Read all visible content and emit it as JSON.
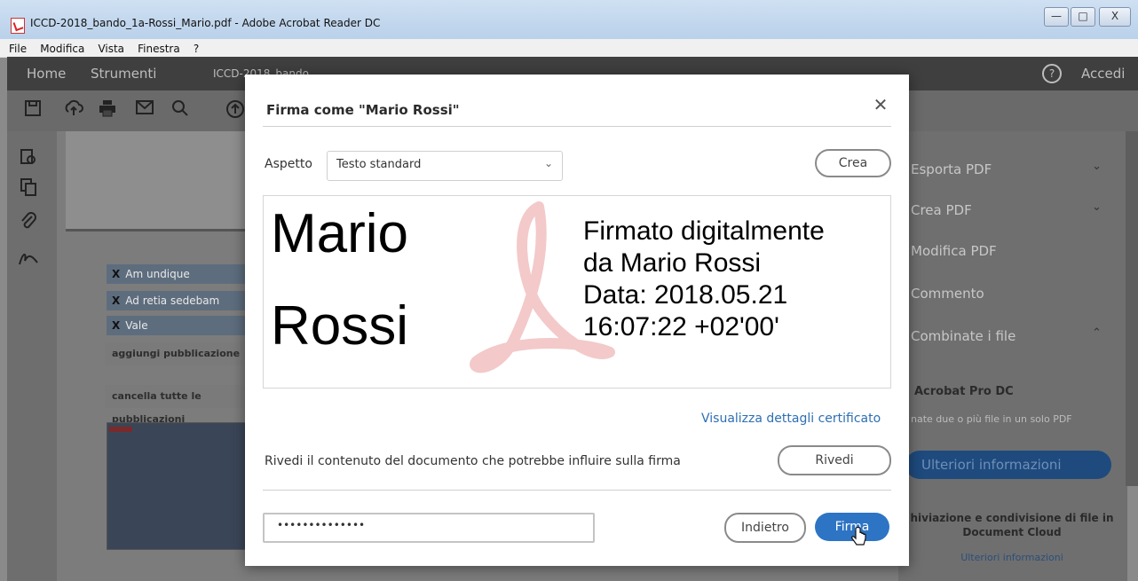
{
  "window": {
    "title": "ICCD-2018_bando_1a-Rossi_Mario.pdf - Adobe Acrobat Reader DC",
    "controls": [
      "—",
      "□",
      "X"
    ]
  },
  "menu": [
    "File",
    "Modifica",
    "Vista",
    "Finestra",
    "?"
  ],
  "topnav": {
    "home": "Home",
    "tools": "Strumenti",
    "doc_tab": "ICCD-2018_bando...",
    "help": "?",
    "signin": "Accedi"
  },
  "document": {
    "rows": [
      {
        "mark": "X",
        "text": "Am undique"
      },
      {
        "mark": "X",
        "text": "Ad retia sedebam"
      },
      {
        "mark": "X",
        "text": "Vale"
      }
    ],
    "add_pub": "aggiungi pubblicazione",
    "clear_pub": "cancella tutte le pubblicazioni"
  },
  "right_panel": {
    "items": [
      {
        "label": "Esporta PDF",
        "chev": "⌄"
      },
      {
        "label": "Crea PDF",
        "chev": "⌄"
      },
      {
        "label": "Modifica PDF"
      },
      {
        "label": "Commento"
      },
      {
        "label": "Combinate i file",
        "chev": "⌃"
      }
    ],
    "promo_title": "Acrobat Pro DC",
    "promo_text": "nate due o più file in un solo PDF",
    "promo_button": "Ulteriori informazioni",
    "cloud_title": "hiviazione e condivisione di file in Document Cloud",
    "cloud_link": "Ulteriori informazioni"
  },
  "dialog": {
    "title": "Firma come \"Mario Rossi\"",
    "appearance_label": "Aspetto",
    "appearance_value": "Testo standard",
    "create_button": "Crea",
    "signature_name_line1": "Mario",
    "signature_name_line2": "Rossi",
    "signature_info": [
      "Firmato digitalmente",
      "da Mario Rossi",
      "Data: 2018.05.21",
      "16:07:22 +02'00'"
    ],
    "cert_link": "Visualizza dettagli certificato",
    "review_text": "Rivedi il contenuto del documento che potrebbe influire sulla firma",
    "review_button": "Rivedi",
    "password_value": "••••••••••••••",
    "back_button": "Indietro",
    "sign_button": "Firma"
  },
  "colors": {
    "accent": "#2d74c4",
    "link": "#2d6fb3"
  }
}
